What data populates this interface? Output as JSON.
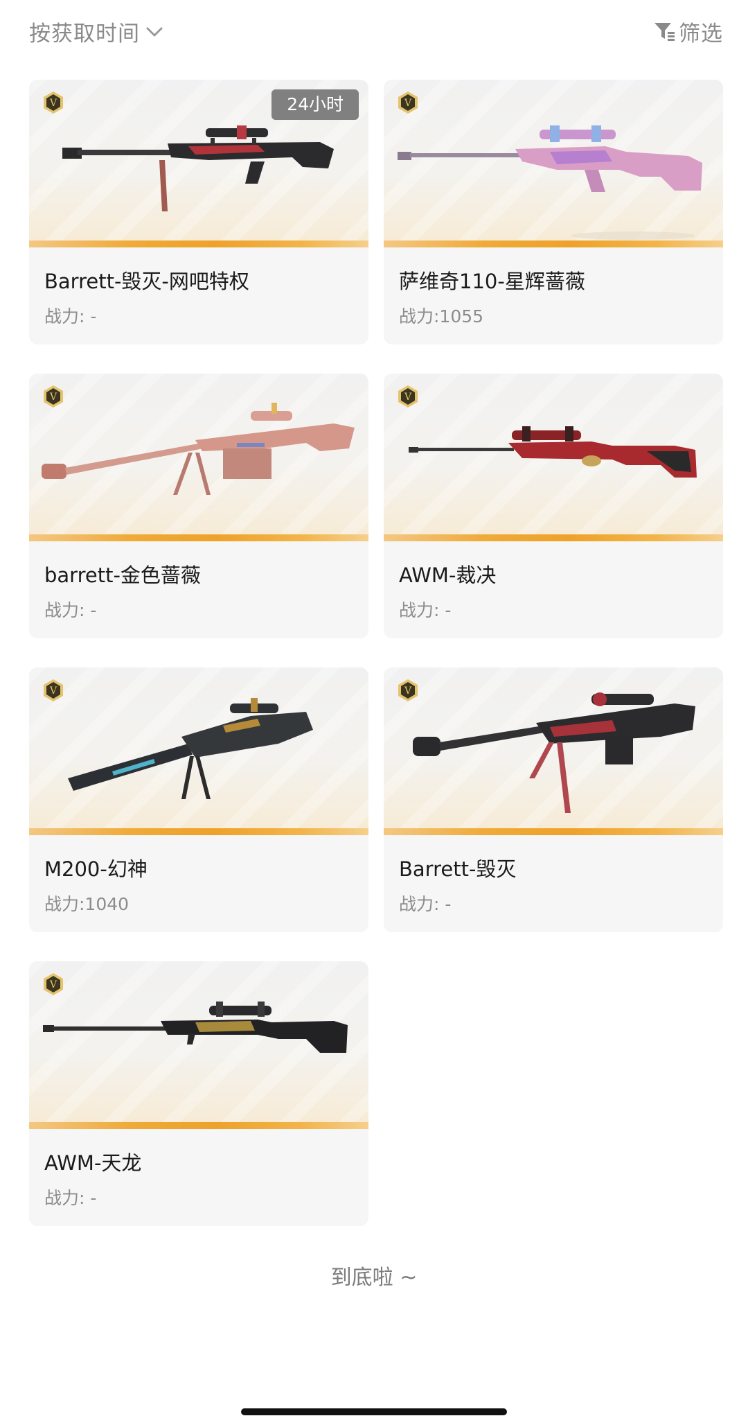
{
  "header": {
    "sort_label": "按获取时间",
    "filter_label": "筛选"
  },
  "items": [
    {
      "name": "Barrett-毁灭-网吧特权",
      "power": "战力: -",
      "badge": "24小时",
      "style": "barrett-dark"
    },
    {
      "name": "萨维奇110-星辉蔷薇",
      "power": "战力:1055",
      "badge": "",
      "style": "savage-pink"
    },
    {
      "name": "barrett-金色蔷薇",
      "power": "战力: -",
      "badge": "",
      "style": "barrett-rose"
    },
    {
      "name": "AWM-裁决",
      "power": "战力: -",
      "badge": "",
      "style": "awm-red"
    },
    {
      "name": "M200-幻神",
      "power": "战力:1040",
      "badge": "",
      "style": "m200-dark"
    },
    {
      "name": "Barrett-毁灭",
      "power": "战力: -",
      "badge": "",
      "style": "barrett-red"
    },
    {
      "name": "AWM-天龙",
      "power": "战力: -",
      "badge": "",
      "style": "awm-black"
    }
  ],
  "footer": {
    "end_text": "到底啦 ~"
  },
  "colors": {
    "accent_bar": "#efaa38",
    "muted_text": "#8c8c8c",
    "badge_bg": "#808080"
  }
}
